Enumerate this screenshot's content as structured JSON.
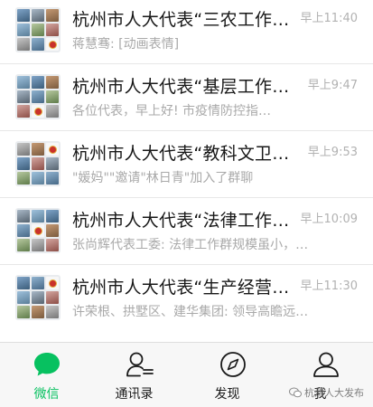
{
  "chats": [
    {
      "title": "杭州市人大代表“三农工作…",
      "time": "早上11:40",
      "preview": "蒋慧骞: [动画表情]"
    },
    {
      "title": "杭州市人大代表“基层工作…",
      "time": "早上9:47",
      "preview": "各位代表，早上好!        市疫情防控指…"
    },
    {
      "title": "杭州市人大代表“教科文卫…",
      "time": "早上9:53",
      "preview": "\"媛妈\"\"邀请\"林日青\"加入了群聊"
    },
    {
      "title": "杭州市人大代表“法律工作…",
      "time": "早上10:09",
      "preview": "张尚辉代表工委: 法律工作群规模虽小，…"
    },
    {
      "title": "杭州市人大代表“生产经营…",
      "time": "早上11:30",
      "preview": "许荣根、拱墅区、建华集团: 领导高瞻远…"
    }
  ],
  "tabs": [
    {
      "label": "微信",
      "icon": "chat-bubble-icon",
      "active": true
    },
    {
      "label": "通讯录",
      "icon": "contacts-icon",
      "active": false
    },
    {
      "label": "发现",
      "icon": "compass-icon",
      "active": false
    },
    {
      "label": "我",
      "icon": "profile-icon",
      "active": false
    }
  ],
  "watermark": "杭州人大发布",
  "colors": {
    "accent": "#07c160",
    "title": "#181818",
    "secondary": "#a9a9a9",
    "tabbar_bg": "#f7f7f7"
  }
}
